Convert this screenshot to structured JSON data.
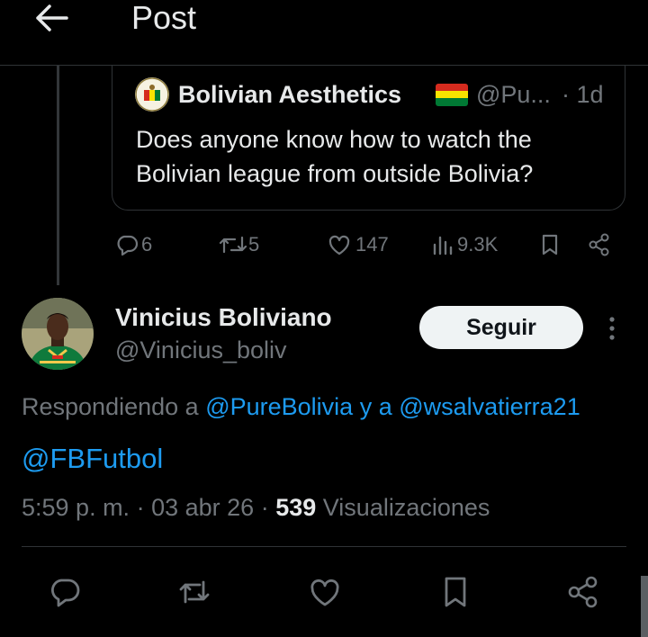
{
  "header": {
    "title": "Post",
    "back_icon": "arrow-left-icon"
  },
  "quoted_post": {
    "author_name": "Bolivian Aesthetics",
    "handle": "@Pu...",
    "separator": "·",
    "time": "1d",
    "text": "Does anyone know how to watch the Bolivian league from outside Bolivia?",
    "flag": "bolivia-flag-icon"
  },
  "actions": {
    "replies": "6",
    "reposts": "5",
    "likes": "147",
    "views": "9.3K"
  },
  "reply_post": {
    "author_name": "Vinicius Boliviano",
    "handle": "@Vinicius_boliv",
    "follow_label": "Seguir",
    "replying_prefix": "Respondiendo a",
    "replying_to_1": "@PureBolivia",
    "replying_join": "y a",
    "replying_to_2": "@wsalvatierra21",
    "body": "@FBFutbol",
    "time": "5:59 p. m.",
    "date": "03 abr 26",
    "view_count": "539",
    "view_label": "Visualizaciones"
  },
  "colors": {
    "background": "#000000",
    "text_primary": "#e7e9ea",
    "text_secondary": "#71767b",
    "link": "#1d9bf0",
    "border": "#2f3336"
  }
}
